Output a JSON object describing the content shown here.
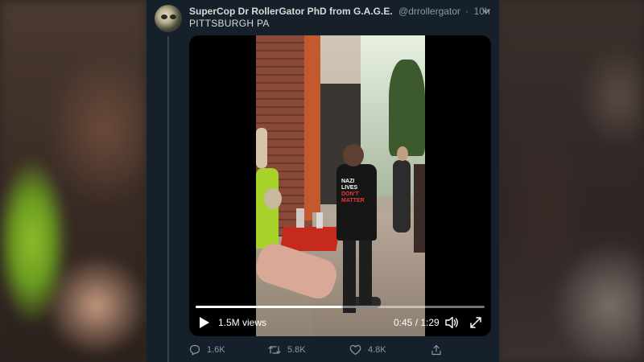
{
  "tweet": {
    "author_name": "SuperCop Dr RollerGator PhD from G.A.G.E.",
    "handle": "@drrollergator",
    "separator": "·",
    "time": "10h",
    "text": "PITTSBURGH PA",
    "avatar_icon": "gator-avatar",
    "menu_icon": "chevron-down-icon"
  },
  "video": {
    "views": "1.5M views",
    "timecode": "0:45 / 1:29",
    "progress": 0.506,
    "play_icon": "play-icon",
    "volume_icon": "volume-icon",
    "fullscreen_icon": "fullscreen-icon",
    "shirt_text": [
      "NAZI",
      "LIVES",
      "DON'T",
      "MATTER"
    ]
  },
  "actions": {
    "replies": "1.6K",
    "retweets": "5.8K",
    "likes": "4.8K",
    "share_icon": "share-icon"
  },
  "colors": {
    "card_bg": "#15202b",
    "text_primary": "#d9d9d9",
    "text_secondary": "#8899a6",
    "thread_line": "#38444d"
  }
}
